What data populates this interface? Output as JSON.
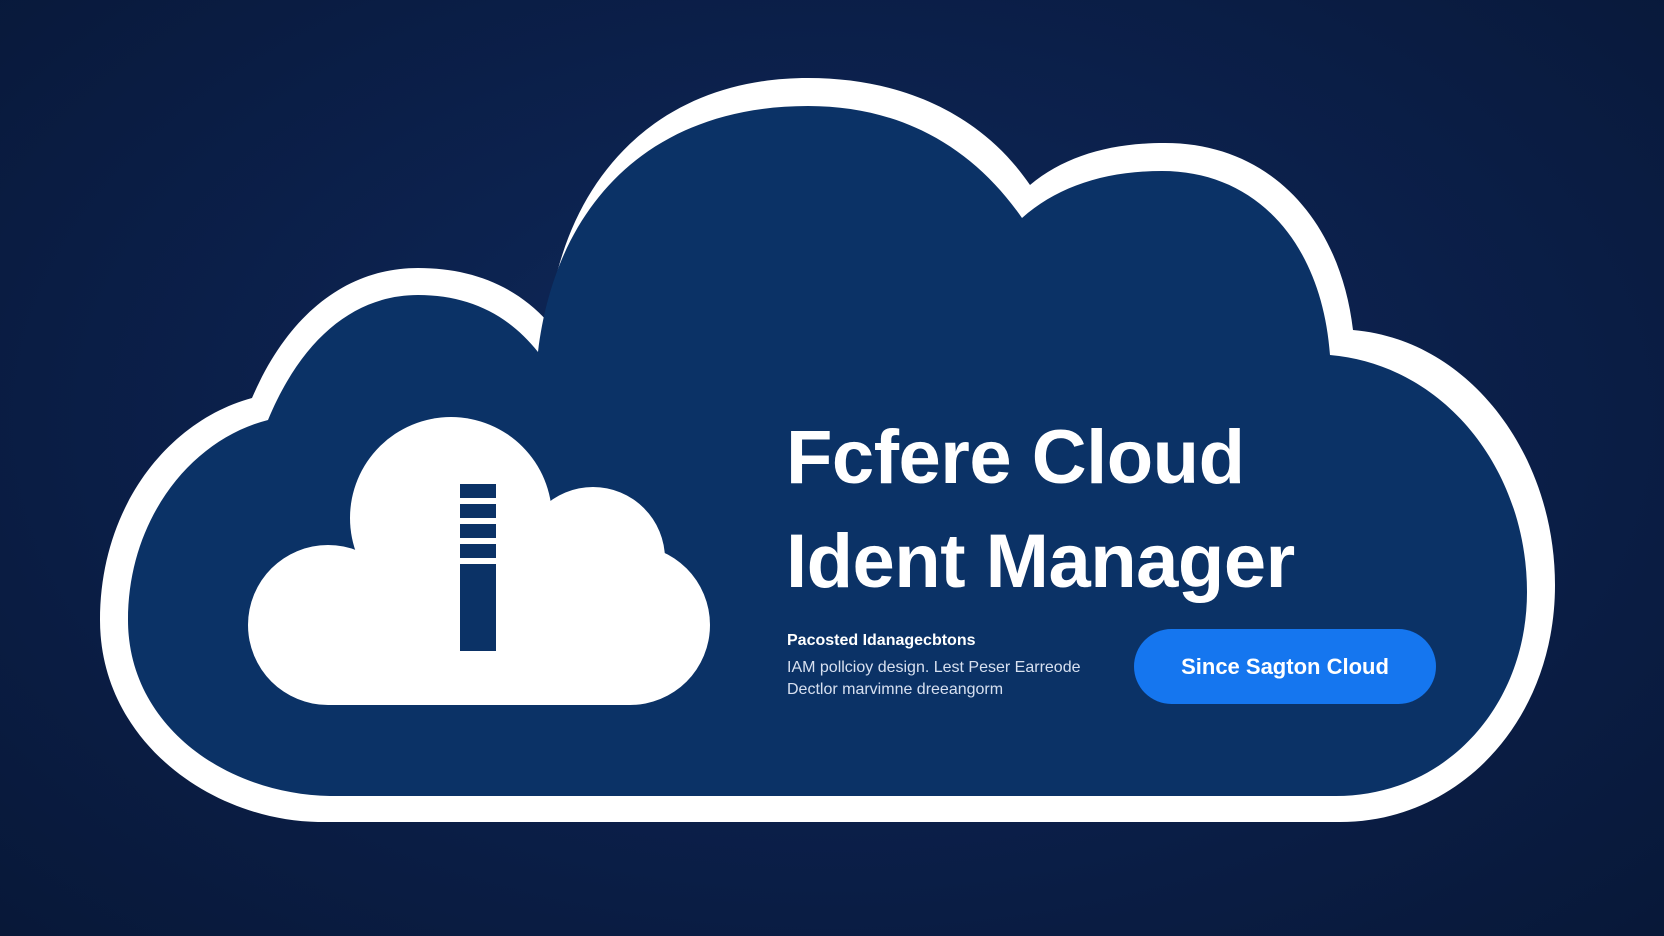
{
  "banner": {
    "title_line1": "Fcfere Cloud",
    "title_line2": "Ident Manager",
    "subheading": "Pacosted Idanagecbtons",
    "description_line1": "IAM pollcioy design. Lest Peser Earreode",
    "description_line2": "Dectlor marvimne dreeangorm",
    "cta_label": "Since Sagton Cloud"
  },
  "icons": {
    "background_shape": "cloud-outline",
    "logo": "cloud-server-icon"
  },
  "colors": {
    "background": "#0a1d44",
    "cloud_fill": "#0b3266",
    "cloud_outline": "#ffffff",
    "logo_fill": "#ffffff",
    "logo_glyph": "#0b3266",
    "cta_background": "#1576ef",
    "text_primary": "#ffffff",
    "text_secondary": "#d7e0f0"
  }
}
